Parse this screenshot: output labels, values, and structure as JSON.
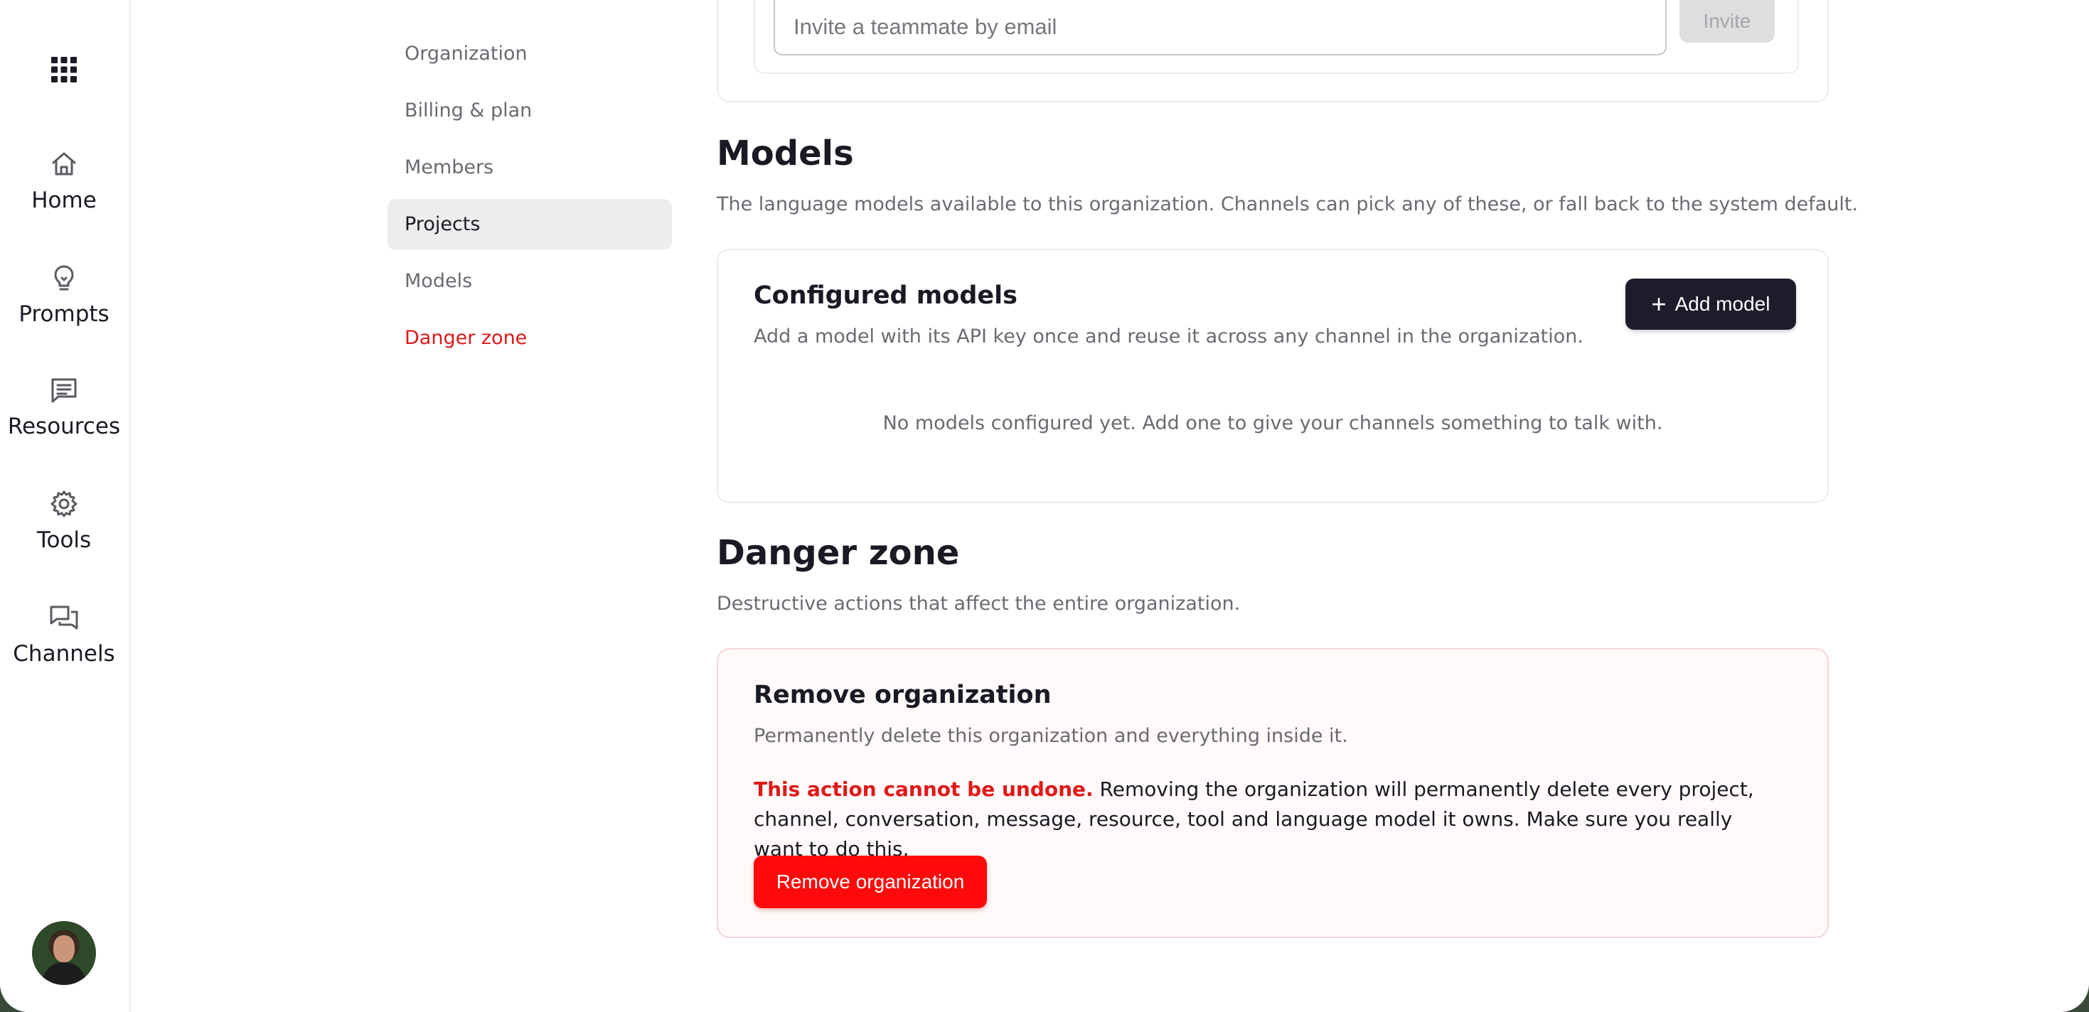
{
  "rail": {
    "items": [
      {
        "label": "Home",
        "icon": "home-icon"
      },
      {
        "label": "Prompts",
        "icon": "lightbulb-icon"
      },
      {
        "label": "Resources",
        "icon": "document-icon"
      },
      {
        "label": "Tools",
        "icon": "gear-icon"
      },
      {
        "label": "Channels",
        "icon": "chat-icon"
      }
    ]
  },
  "subnav": {
    "items": [
      {
        "label": "Organization"
      },
      {
        "label": "Billing & plan"
      },
      {
        "label": "Members"
      },
      {
        "label": "Projects",
        "active": true
      },
      {
        "label": "Models"
      },
      {
        "label": "Danger zone"
      }
    ]
  },
  "invite": {
    "placeholder": "Invite a teammate by email",
    "button_label": "Invite"
  },
  "models": {
    "title": "Models",
    "description": "The language models available to this organization. Channels can pick any of these, or fall back to the system default.",
    "card": {
      "title": "Configured models",
      "description": "Add a model with its API key once and reuse it across any channel in the organization.",
      "add_button_label": "Add model",
      "empty_message": "No models configured yet. Add one to give your channels something to talk with."
    }
  },
  "danger": {
    "title": "Danger zone",
    "description": "Destructive actions that affect the entire organization.",
    "card": {
      "title": "Remove organization",
      "description": "Permanently delete this organization and everything inside it.",
      "warning_strong": "This action cannot be undone.",
      "warning_rest": " Removing the organization will permanently delete every project, channel, conversation, message, resource, tool and language model it owns. Make sure you really want to do this.",
      "button_label": "Remove organization"
    }
  },
  "colors": {
    "accent_dark": "#1c1c2a",
    "danger": "#e01818",
    "danger_button": "#ff0a0a"
  }
}
